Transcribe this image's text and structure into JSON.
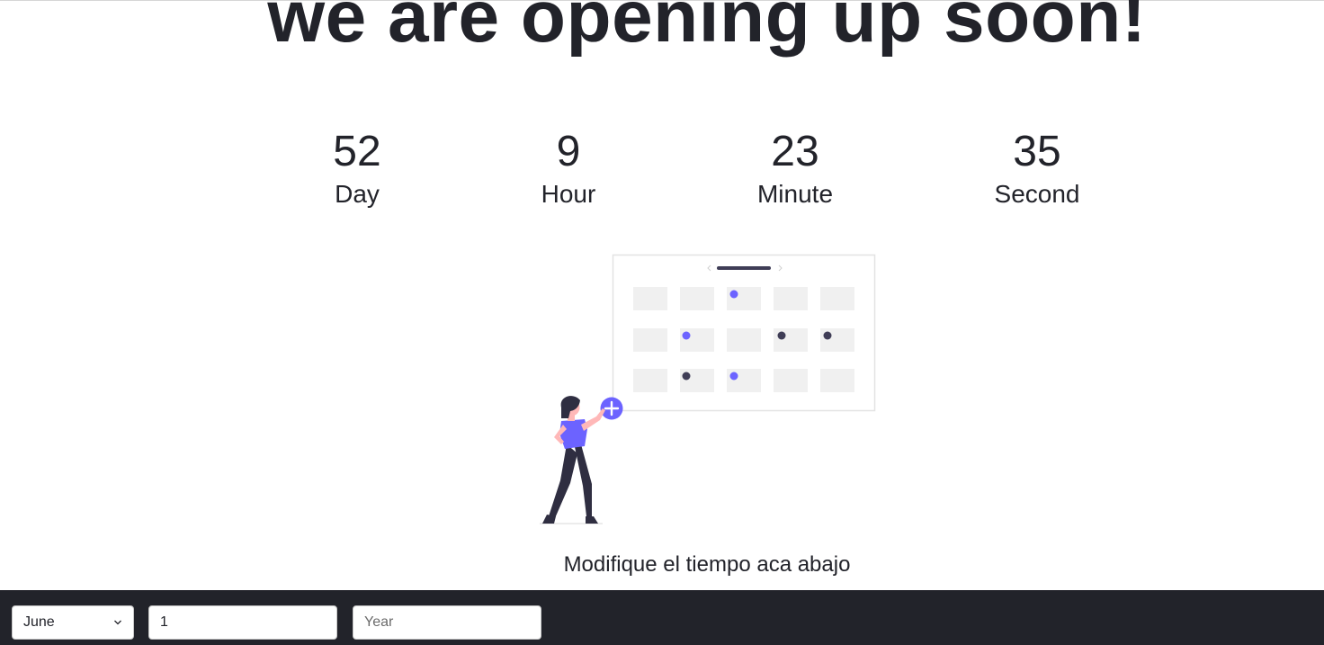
{
  "title": "we are opening up soon!",
  "countdown": [
    {
      "value": "52",
      "label": "Day"
    },
    {
      "value": "9",
      "label": "Hour"
    },
    {
      "value": "23",
      "label": "Minute"
    },
    {
      "value": "35",
      "label": "Second"
    }
  ],
  "instruction": "Modifique el tiempo aca abajo",
  "form": {
    "month_selected": "June",
    "day_value": "1",
    "year_placeholder": "Year"
  },
  "colors": {
    "accent": "#6c63ff",
    "dark": "#22232a",
    "cell": "#f0f0f0"
  }
}
